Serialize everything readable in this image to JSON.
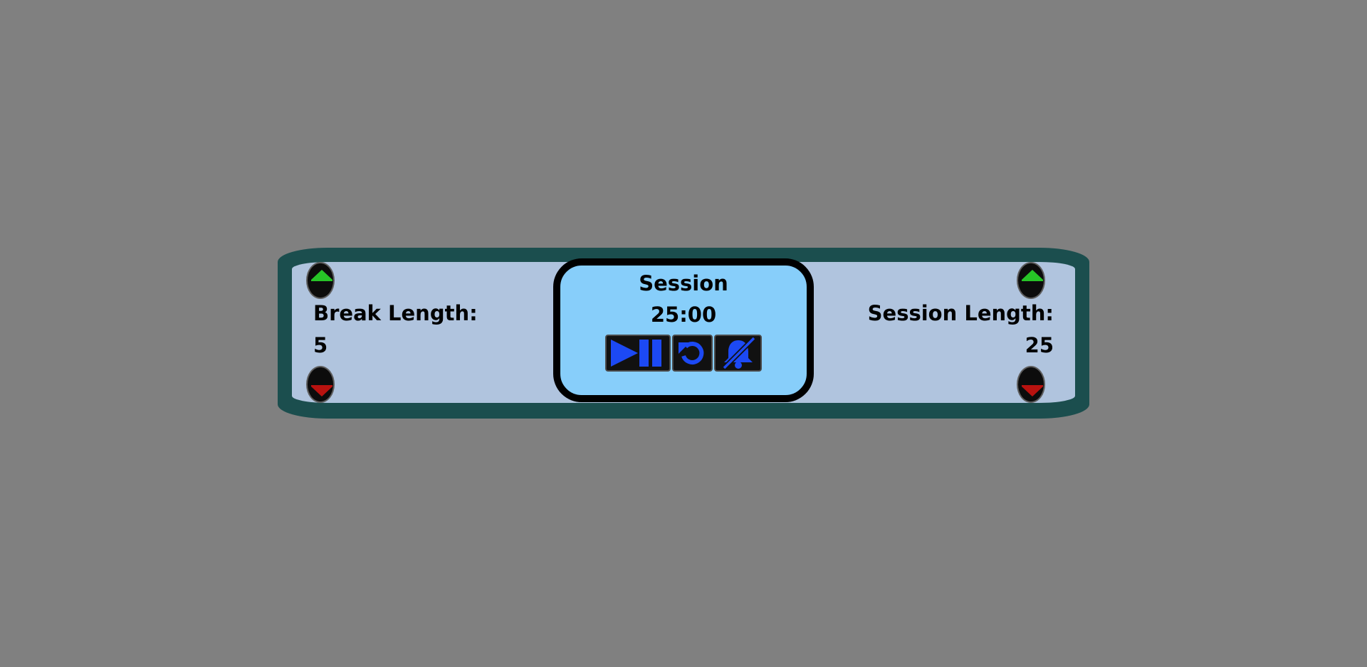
{
  "break": {
    "label": "Break Length:",
    "value": "5"
  },
  "session": {
    "label": "Session Length:",
    "value": "25"
  },
  "timer": {
    "title": "Session",
    "time": "25:00"
  },
  "icons": {
    "increment": "arrow-up-icon",
    "decrement": "arrow-down-icon",
    "start_stop": "play-pause-icon",
    "reset": "reset-icon",
    "sound": "bell-slash-icon"
  },
  "colors": {
    "background": "#808080",
    "frame": "#1b4e4e",
    "panel": "#b0c4de",
    "display": "#87cefa",
    "control_icon": "#1c49f4",
    "increment_arrow": "#27c427",
    "decrement_arrow": "#b8120f"
  }
}
